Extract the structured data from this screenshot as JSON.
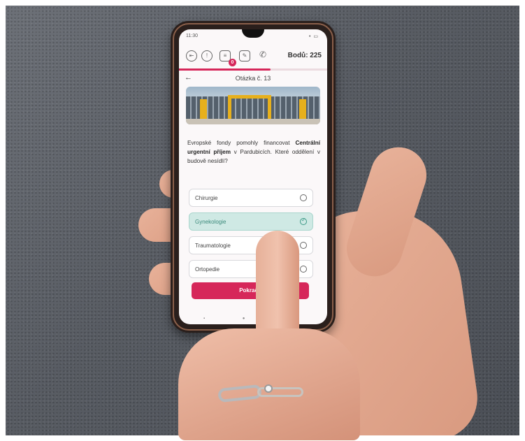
{
  "status_bar": {
    "time": "11:30",
    "battery": "• ▭"
  },
  "header": {
    "icons": [
      "exit-icon",
      "help-icon",
      "inbox-icon",
      "edit-icon",
      "phone-icon"
    ],
    "inbox_badge": "0",
    "points_label": "Bodů: 225"
  },
  "progress": {
    "fraction": 0.62
  },
  "question_header": {
    "back_glyph": "←",
    "title": "Otázka č. 13"
  },
  "question": {
    "text_before": "Evropské fondy pomohly financovat ",
    "text_bold": "Centrální urgentní příjem",
    "text_after": " v Pardubicích. Které oddělení v budově nesídlí?"
  },
  "options": [
    {
      "label": "Chirurgie",
      "selected": false
    },
    {
      "label": "Gynekologie",
      "selected": true
    },
    {
      "label": "Traumatologie",
      "selected": false
    },
    {
      "label": "Ortopedie",
      "selected": false
    }
  ],
  "continue_button": {
    "label": "Pokračo"
  },
  "nav_bar": {
    "glyphs": "▪ ● ◂"
  },
  "colors": {
    "accent": "#d6275a",
    "selected_bg": "#cfe9e4",
    "selected_text": "#3d8b7c"
  }
}
